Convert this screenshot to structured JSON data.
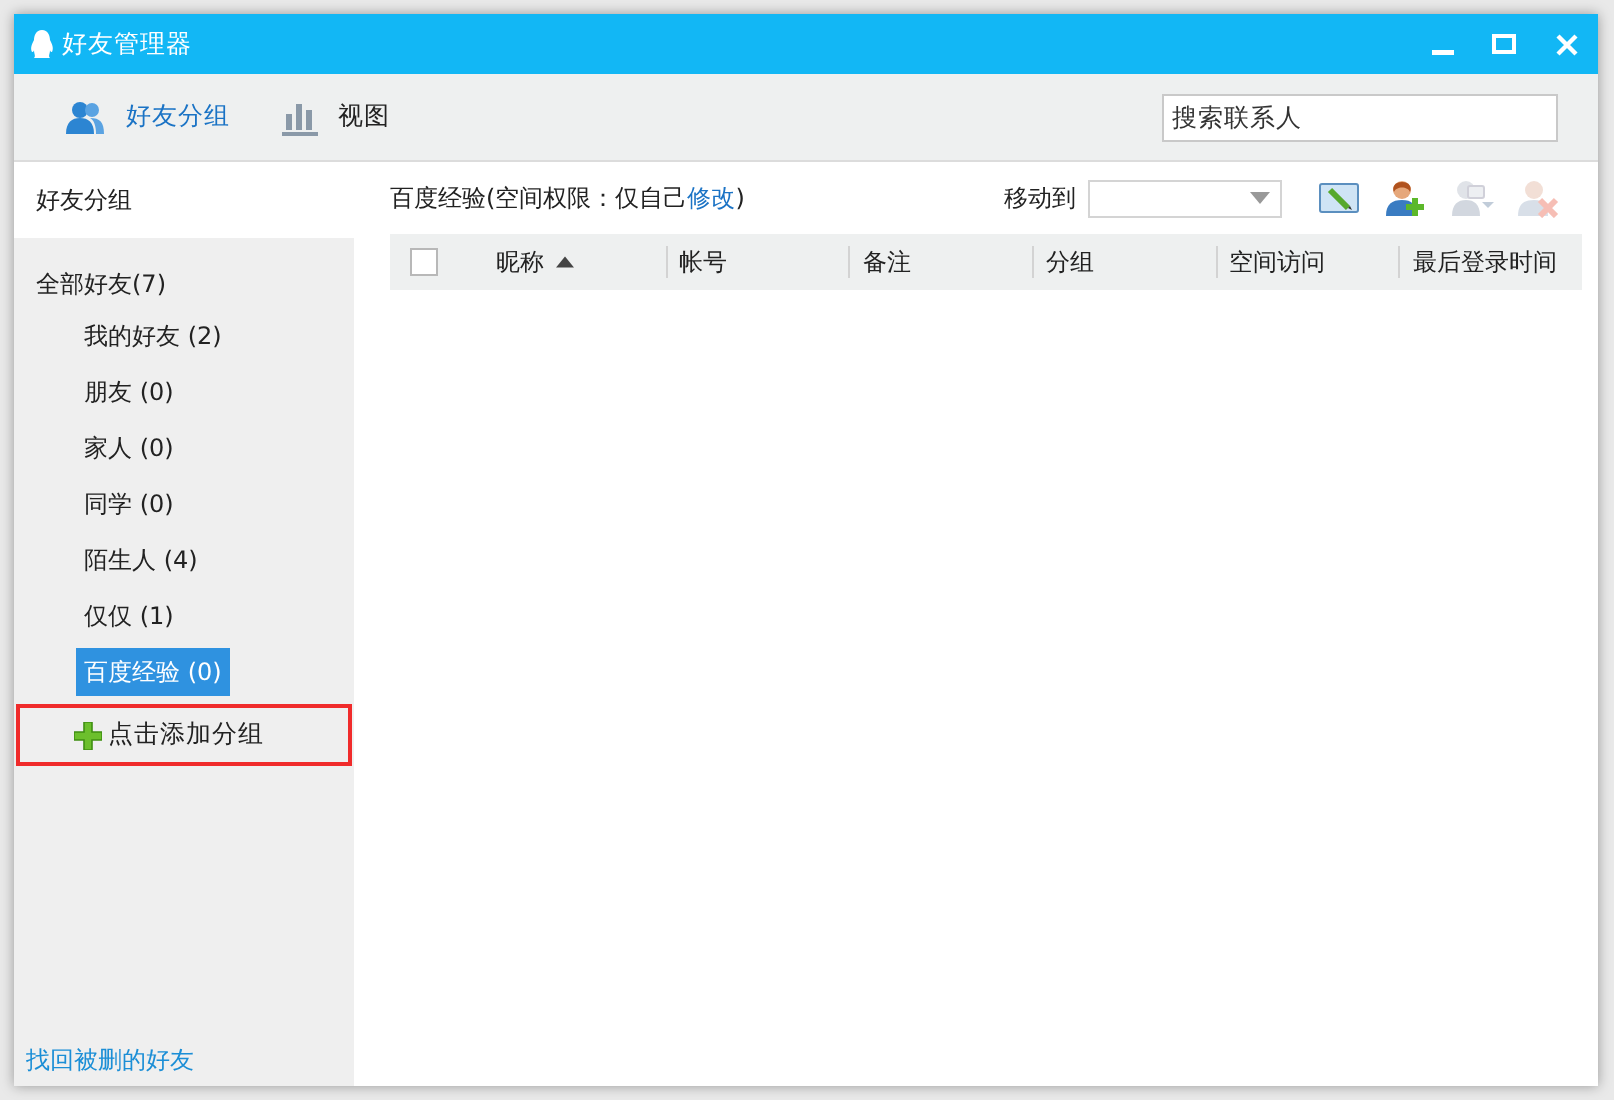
{
  "window": {
    "title": "好友管理器"
  },
  "tabs": [
    {
      "label": "好友分组",
      "kind": "people",
      "selected": true
    },
    {
      "label": "视图",
      "kind": "chart",
      "selected": false
    }
  ],
  "search": {
    "placeholder": "搜索联系人"
  },
  "sidebar": {
    "title": "好友分组",
    "root": {
      "label": "全部好友(7)",
      "selected": false,
      "children": [
        {
          "label": "我的好友 (2)",
          "selected": false
        },
        {
          "label": "朋友 (0)",
          "selected": false
        },
        {
          "label": "家人 (0)",
          "selected": false
        },
        {
          "label": "同学 (0)",
          "selected": false
        },
        {
          "label": "陌生人 (4)",
          "selected": false
        },
        {
          "label": "仅仅 (1)",
          "selected": false
        },
        {
          "label": "百度经验 (0)",
          "selected": true
        }
      ]
    },
    "add_group": {
      "label": "点击添加分组",
      "highlighted": true
    },
    "recover_link": "找回被删的好友"
  },
  "content": {
    "group_label": "百度经验(空间权限：仅自己",
    "modify_link": "修改",
    "group_label_end": ")",
    "move_to": {
      "label": "移动到"
    },
    "toolbar_buttons": [
      {
        "kind": "edit",
        "disabled": false
      },
      {
        "kind": "add",
        "disabled": false
      },
      {
        "kind": "menu",
        "disabled": true
      },
      {
        "kind": "remove",
        "disabled": true
      }
    ],
    "table": {
      "select_all": {
        "checked": false
      },
      "columns": [
        {
          "label": "昵称",
          "sorted": true
        },
        {
          "label": "帐号"
        },
        {
          "label": "备注"
        },
        {
          "label": "分组"
        },
        {
          "label": "空间访问"
        },
        {
          "label": "最后登录时间"
        }
      ]
    }
  }
}
